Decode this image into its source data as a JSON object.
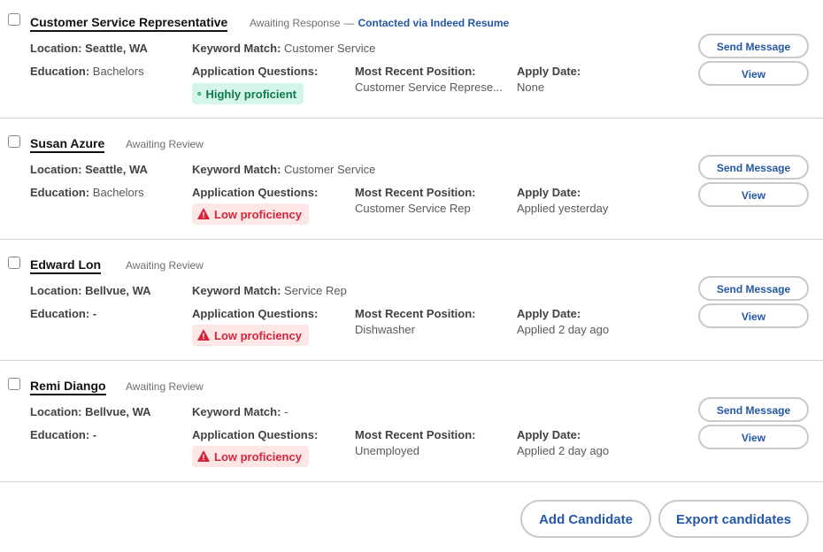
{
  "labels": {
    "location": "Location:",
    "keyword": "Keyword Match:",
    "education": "Education:",
    "questions": "Application Questions:",
    "position": "Most Recent Position:",
    "apply": "Apply Date:"
  },
  "colors": {
    "accent": "#2557a7",
    "good_bg": "#d6f5e9",
    "good_fg": "#0d7a4f",
    "bad_bg": "#fde6e6",
    "bad_fg": "#d4263b"
  },
  "candidates": [
    {
      "name": "Customer Service Representative",
      "status": "Awaiting Response",
      "status_link": "Contacted via Indeed Resume",
      "location": "Seattle, WA",
      "keyword": "Customer Service",
      "education": "Bachelors",
      "proficiency": "Highly proficient",
      "proficiency_icon": "check-circle-icon",
      "position": "Customer Service Represe...",
      "apply_date": "None",
      "send_label": "Send Message",
      "view_label": "View"
    },
    {
      "name": "Susan Azure",
      "status": "Awaiting Review",
      "location": "Seattle, WA",
      "keyword": "Customer Service",
      "education": "Bachelors",
      "proficiency": "Low proficiency",
      "proficiency_icon": "warning-icon",
      "position": "Customer Service Rep",
      "apply_date": "Applied yesterday",
      "send_label": "Send Message",
      "view_label": "View"
    },
    {
      "name": "Edward Lon",
      "status": "Awaiting Review",
      "location": "Bellvue, WA",
      "keyword": "Service Rep",
      "education": "-",
      "proficiency": "Low proficiency",
      "proficiency_icon": "warning-icon",
      "position": "Dishwasher",
      "apply_date": "Applied 2 day ago",
      "send_label": "Send Message",
      "view_label": "View"
    },
    {
      "name": "Remi Diango",
      "status": "Awaiting Review",
      "location": "Bellvue, WA",
      "keyword": "-",
      "education": "-",
      "proficiency": "Low proficiency",
      "proficiency_icon": "warning-icon",
      "position": "Unemployed",
      "apply_date": "Applied 2 day ago",
      "send_label": "Send Message",
      "view_label": "View"
    }
  ],
  "footer": {
    "add_label": "Add Candidate",
    "export_label": "Export candidates"
  }
}
